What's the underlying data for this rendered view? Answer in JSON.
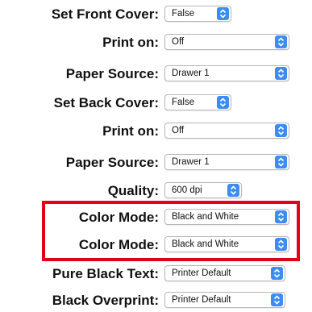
{
  "settings": [
    {
      "label": "Set Front Cover:",
      "value": "False"
    },
    {
      "label": "Print on:",
      "value": "Off"
    },
    {
      "label": "Paper Source:",
      "value": "Drawer 1"
    },
    {
      "label": "Set Back Cover:",
      "value": "False"
    },
    {
      "label": "Print on:",
      "value": "Off"
    },
    {
      "label": "Paper Source:",
      "value": "Drawer 1"
    },
    {
      "label": "Quality:",
      "value": "600 dpi"
    },
    {
      "label": "Color Mode:",
      "value": "Black and White"
    },
    {
      "label": "Color Mode:",
      "value": "Black and White"
    },
    {
      "label": "Pure Black Text:",
      "value": "Printer Default"
    },
    {
      "label": "Black Overprint:",
      "value": "Printer Default"
    }
  ],
  "colors": {
    "accent": "#3b8cf5",
    "highlight_box": "#e3001b"
  },
  "icons": {
    "popup_arrow": "chevron-up-down-icon"
  }
}
